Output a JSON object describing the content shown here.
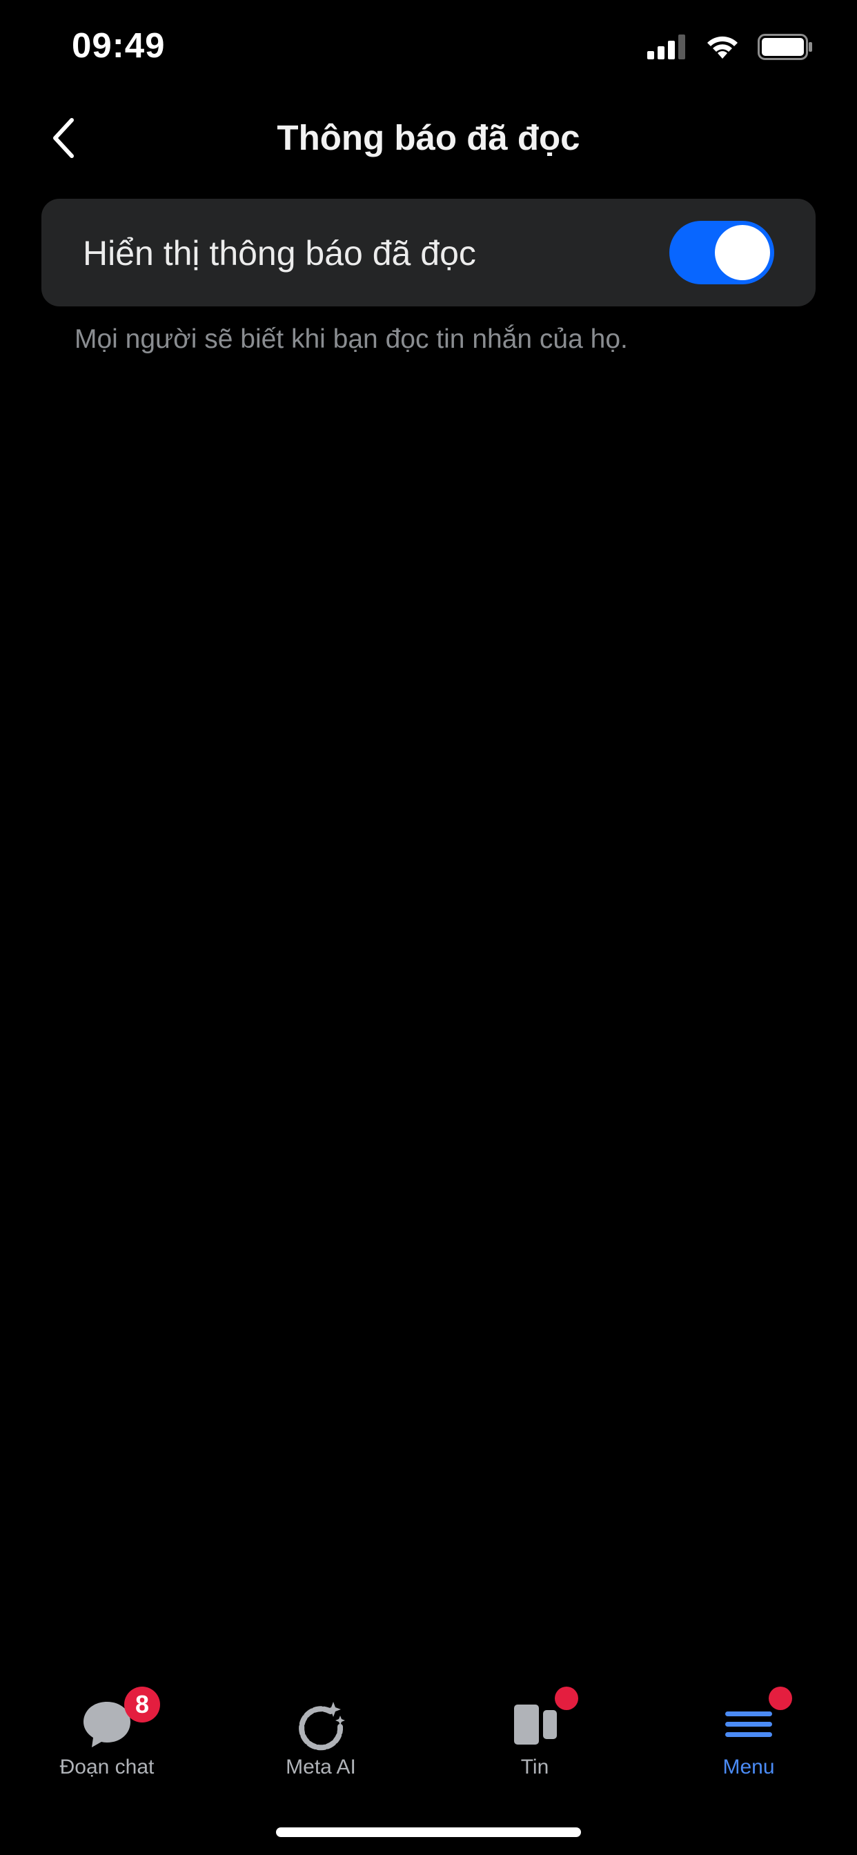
{
  "status_bar": {
    "time": "09:49",
    "icons": [
      "signal-icon",
      "wifi-icon",
      "battery-icon"
    ]
  },
  "header": {
    "back_icon": "chevron-left-icon",
    "title": "Thông báo đã đọc"
  },
  "setting": {
    "label": "Hiển thị thông báo đã đọc",
    "enabled": true,
    "description": "Mọi người sẽ biết khi bạn đọc tin nhắn của họ."
  },
  "tabs": [
    {
      "label": "Đoạn chat",
      "icon": "chat-bubble-icon",
      "badge": "8",
      "active": false
    },
    {
      "label": "Meta AI",
      "icon": "meta-ai-icon",
      "active": false
    },
    {
      "label": "Tin",
      "icon": "stories-icon",
      "dot": true,
      "active": false
    },
    {
      "label": "Menu",
      "icon": "menu-icon",
      "dot": true,
      "active": true
    }
  ],
  "colors": {
    "background": "#000000",
    "card": "#242526",
    "toggle_on": "#0866FF",
    "active_tab": "#4B8BF5",
    "badge": "#E41E3F",
    "muted_text": "#8A8D91"
  }
}
